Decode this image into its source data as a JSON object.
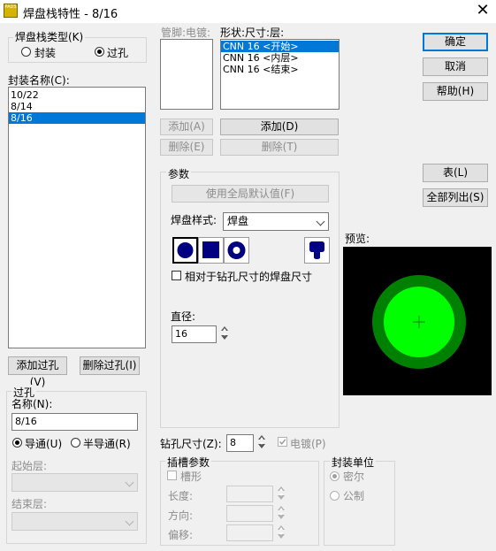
{
  "window": {
    "title": "焊盘栈特性 - 8/16",
    "app_icon_text": "PADS"
  },
  "pad_stack_type": {
    "label": "焊盘栈类型(K)",
    "options": [
      {
        "label": "封装",
        "selected": false
      },
      {
        "label": "过孔",
        "selected": true
      }
    ]
  },
  "package_names": {
    "label": "封装名称(C):",
    "items": [
      {
        "text": "10/22",
        "selected": false
      },
      {
        "text": "8/14",
        "selected": false
      },
      {
        "text": "8/16",
        "selected": true
      }
    ]
  },
  "add_via_button": "添加过孔(V)",
  "delete_via_button": "删除过孔(I)",
  "via_group": {
    "label": "过孔",
    "name_label": "名称(N):",
    "name_value": "8/16",
    "conduct_options": [
      {
        "label": "导通(U)",
        "selected": true
      },
      {
        "label": "半导通(R)",
        "selected": false
      }
    ],
    "start_layer_label": "起始层:",
    "end_layer_label": "结束层:"
  },
  "pin_plating": {
    "label": "管脚:电镀:"
  },
  "pin_add_button": "添加(A)",
  "pin_delete_button": "删除(E)",
  "shape_list": {
    "label": "形状:尺寸:层:",
    "items": [
      {
        "text": "CNN 16 <开始>",
        "selected": true
      },
      {
        "text": "CNN 16 <内层>",
        "selected": false
      },
      {
        "text": "CNN 16 <结束>",
        "selected": false
      }
    ]
  },
  "shape_add_button": "添加(D)",
  "shape_delete_button": "删除(T)",
  "params": {
    "label": "参数",
    "use_global_button": "使用全局默认值(F)",
    "pad_style_label": "焊盘样式:",
    "pad_style_value": "焊盘",
    "shape_buttons": [
      "round-pad-icon",
      "square-pad-icon",
      "annular-pad-icon",
      "odd-shape-pad-icon"
    ],
    "relative_checkbox_label": "相对于钻孔尺寸的焊盘尺寸",
    "relative_checked": false,
    "diameter_label": "直径:",
    "diameter_value": "16"
  },
  "drill": {
    "size_label": "钻孔尺寸(Z):",
    "size_value": "8",
    "plated_label": "电镀(P)",
    "plated_checked": true
  },
  "slot_params": {
    "label": "插槽参数",
    "slot_label": "槽形",
    "length_label": "长度:",
    "direction_label": "方向:",
    "offset_label": "偏移:"
  },
  "units": {
    "label": "封装单位",
    "options": [
      {
        "label": "密尔",
        "selected": true
      },
      {
        "label": "公制",
        "selected": false
      }
    ]
  },
  "buttons": {
    "ok": "确定",
    "cancel": "取消",
    "help": "帮助(H)",
    "table": "表(L)",
    "list_all": "全部列出(S)"
  },
  "preview": {
    "label": "预览:",
    "colors": {
      "background": "#000000",
      "outer_ring": "#008000",
      "pad": "#00ff00",
      "crosshair": "#008000"
    }
  }
}
